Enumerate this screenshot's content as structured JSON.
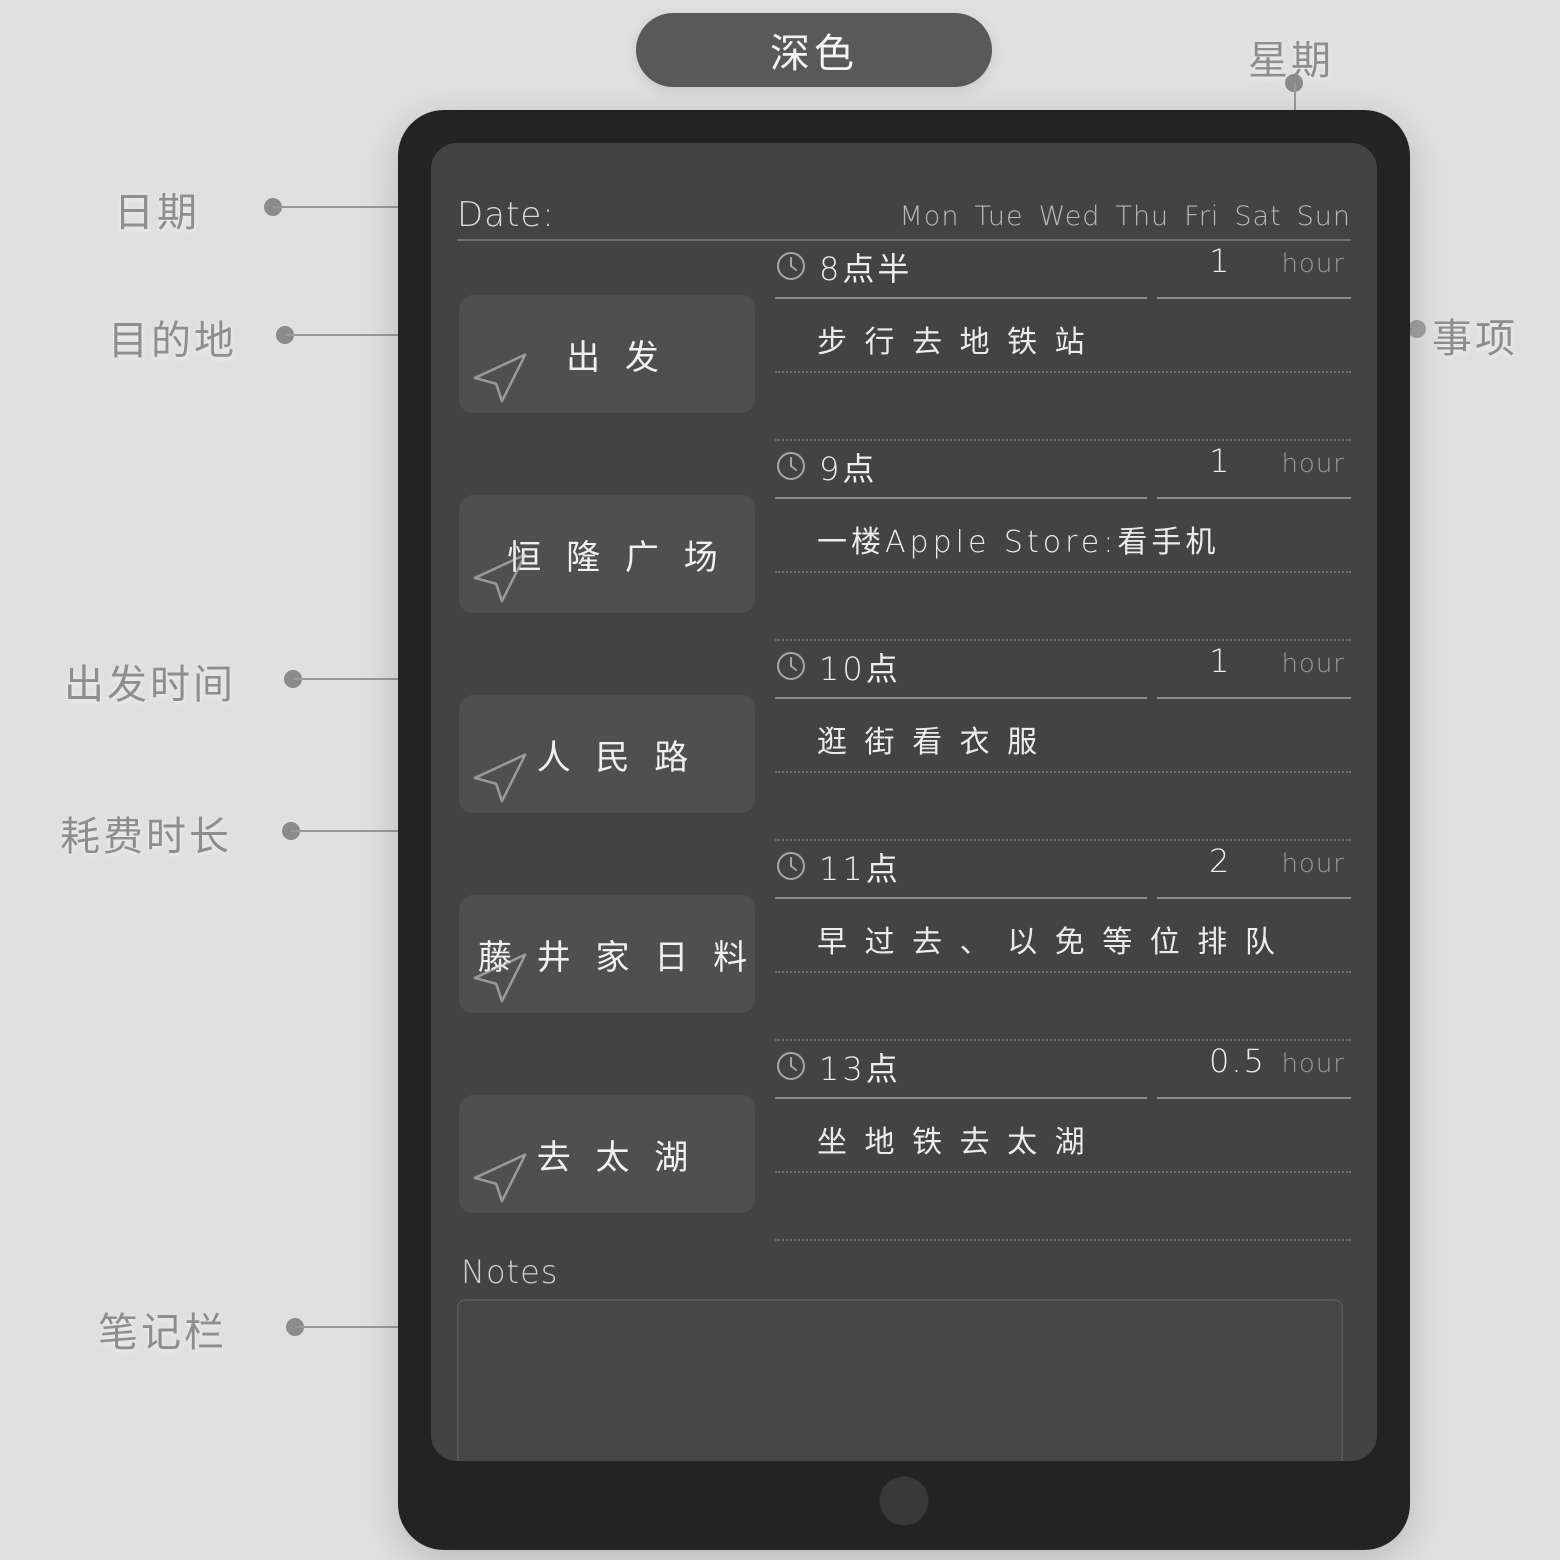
{
  "title_badge": {
    "label": "深色"
  },
  "device": {
    "home_button_name": "home-button"
  },
  "planner": {
    "date_label": "Date:",
    "weekdays": [
      "Mon",
      "Tue",
      "Wed",
      "Thu",
      "Fri",
      "Sat",
      "Sun"
    ],
    "duration_unit": "hour",
    "rows": [
      {
        "destination": "出 发",
        "time": "8点半",
        "task": "步 行 去 地 铁 站",
        "duration": "1"
      },
      {
        "destination": "恒 隆 广 场",
        "time": "9点",
        "task": "一楼Apple Store:看手机",
        "duration": "1"
      },
      {
        "destination": "人 民 路",
        "time": "10点",
        "task": "逛 街 看 衣 服",
        "duration": "1"
      },
      {
        "destination": "藤 井 家 日 料",
        "time": "11点",
        "task": "早 过 去 、 以 免 等 位 排 队",
        "duration": "2"
      },
      {
        "destination": "去 太 湖",
        "time": "13点",
        "task": "坐 地 铁 去 太 湖",
        "duration": "0.5"
      }
    ],
    "notes_label": "Notes",
    "notes_value": ""
  },
  "annotations": {
    "date": "日期",
    "destination": "目的地",
    "depart_time": "出发时间",
    "duration": "耗费时长",
    "notes": "笔记栏",
    "weekday": "星期",
    "items": "事项"
  },
  "colors": {
    "page_bg": "#e0e0e0",
    "pill_bg": "#595959",
    "tablet_frame": "#232323",
    "screen_bg": "#434343",
    "card_bg": "#4f4f4f",
    "text_primary": "#ededed",
    "text_muted": "#9c9c9c",
    "annotation": "#8e8e8e"
  }
}
